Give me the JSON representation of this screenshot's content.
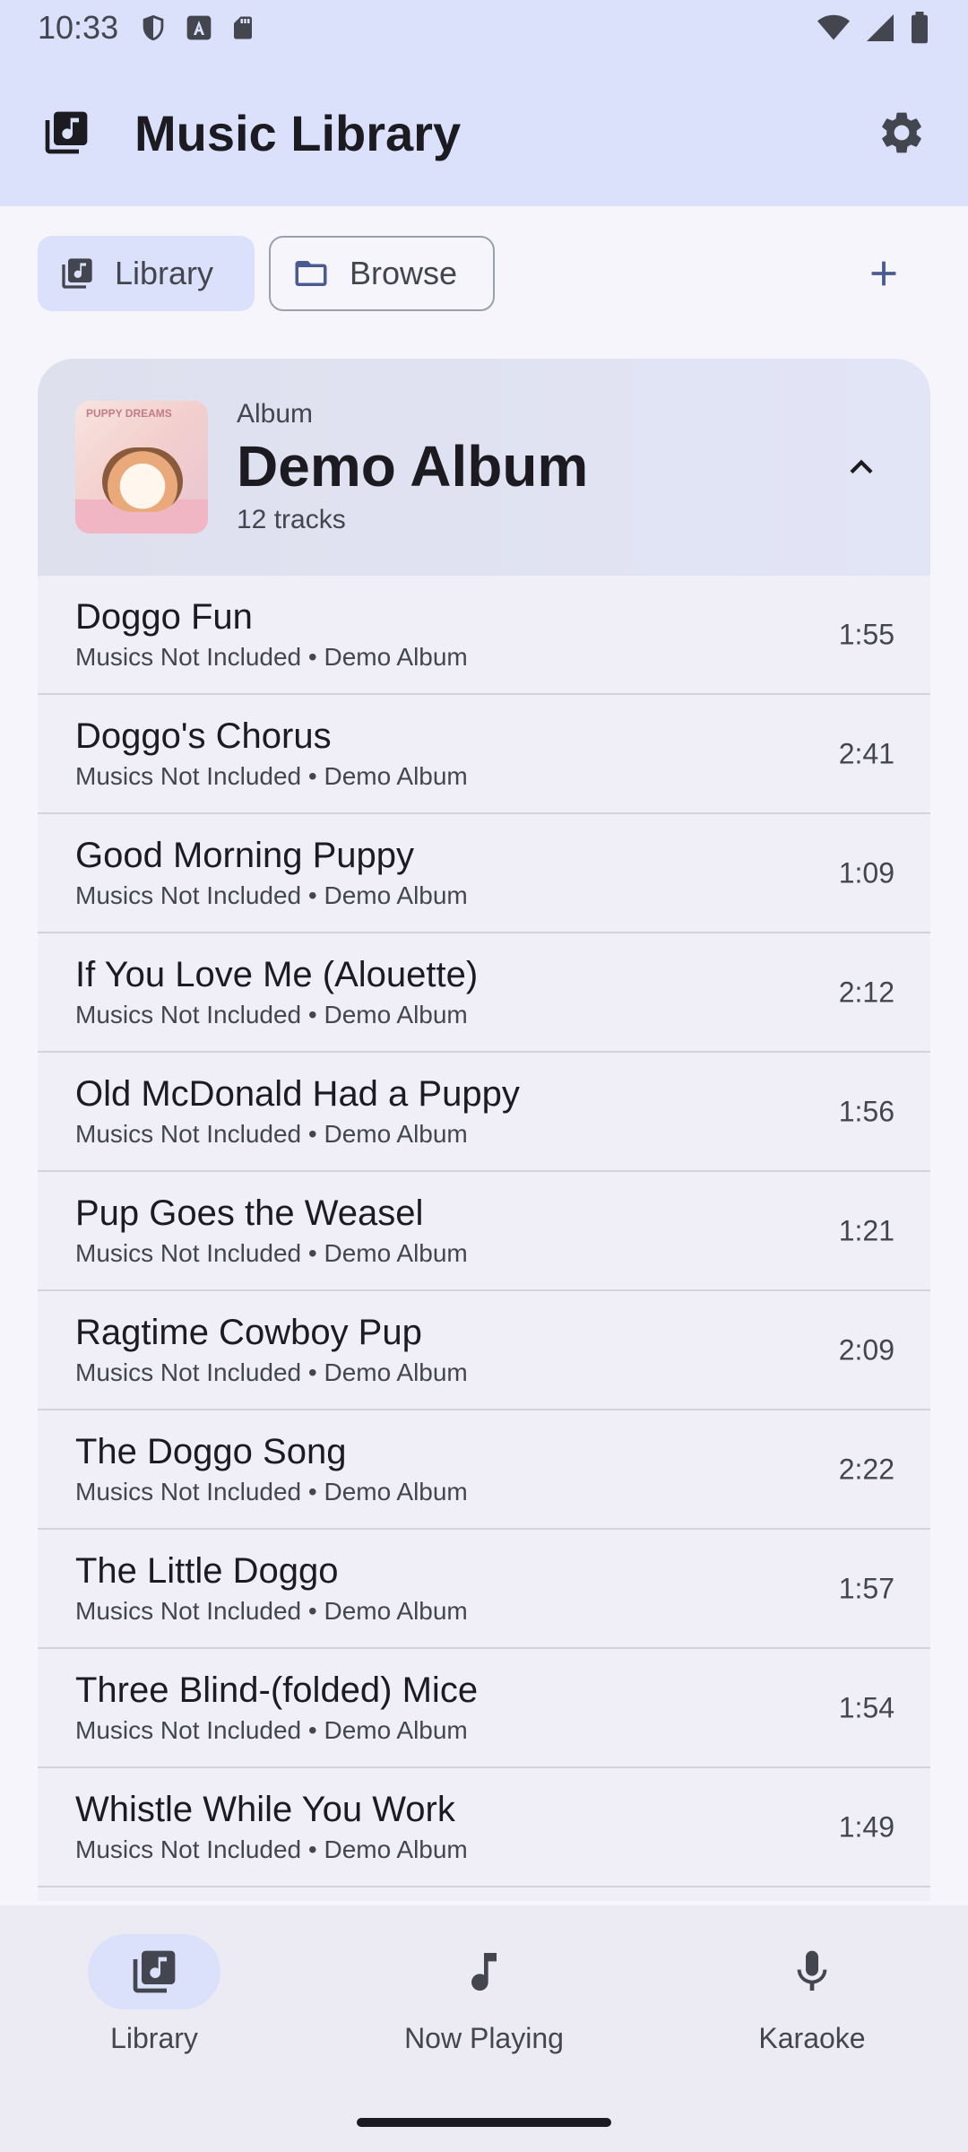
{
  "status_bar": {
    "time": "10:33"
  },
  "app_bar": {
    "title": "Music Library"
  },
  "filters": {
    "library_label": "Library",
    "browse_label": "Browse"
  },
  "album": {
    "kind": "Album",
    "name": "Demo Album",
    "track_count": "12 tracks",
    "cover_text": "PUPPY DREAMS"
  },
  "tracks": [
    {
      "title": "Doggo Fun",
      "subtitle": "Musics Not Included • Demo Album",
      "duration": "1:55"
    },
    {
      "title": "Doggo's Chorus",
      "subtitle": "Musics Not Included • Demo Album",
      "duration": "2:41"
    },
    {
      "title": "Good Morning Puppy",
      "subtitle": "Musics Not Included • Demo Album",
      "duration": "1:09"
    },
    {
      "title": "If You Love Me (Alouette)",
      "subtitle": "Musics Not Included • Demo Album",
      "duration": "2:12"
    },
    {
      "title": "Old McDonald Had a Puppy",
      "subtitle": "Musics Not Included • Demo Album",
      "duration": "1:56"
    },
    {
      "title": "Pup Goes the Weasel",
      "subtitle": "Musics Not Included • Demo Album",
      "duration": "1:21"
    },
    {
      "title": "Ragtime Cowboy Pup",
      "subtitle": "Musics Not Included • Demo Album",
      "duration": "2:09"
    },
    {
      "title": "The Doggo Song",
      "subtitle": "Musics Not Included • Demo Album",
      "duration": "2:22"
    },
    {
      "title": "The Little Doggo",
      "subtitle": "Musics Not Included • Demo Album",
      "duration": "1:57"
    },
    {
      "title": "Three Blind-(folded) Mice",
      "subtitle": "Musics Not Included • Demo Album",
      "duration": "1:54"
    },
    {
      "title": "Whistle While You Work",
      "subtitle": "Musics Not Included • Demo Album",
      "duration": "1:49"
    }
  ],
  "bottom_nav": {
    "library": "Library",
    "now_playing": "Now Playing",
    "karaoke": "Karaoke"
  },
  "colors": {
    "accent": "#dbe1fb",
    "primary": "#4a5a92",
    "background": "#f6f5fb"
  }
}
